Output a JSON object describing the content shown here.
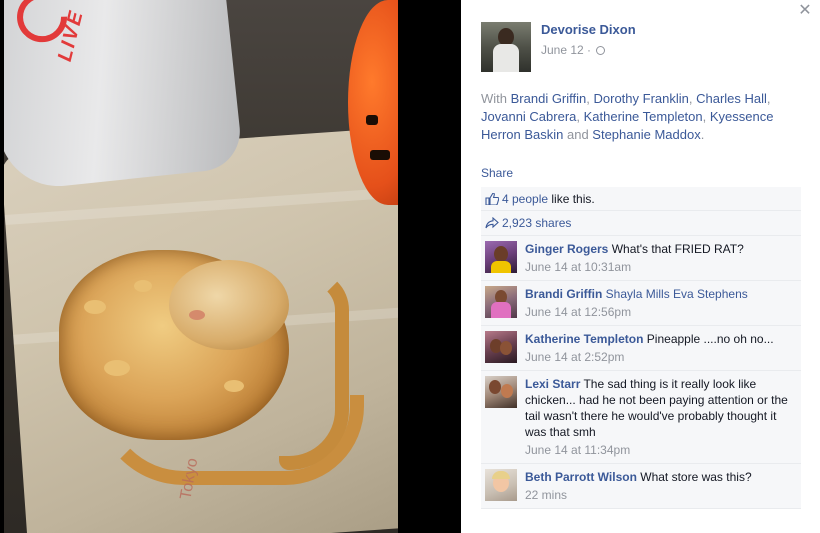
{
  "photo": {
    "cup_text": "LIVE",
    "wrapper_text": "Tokyo"
  },
  "close_icon": "✕",
  "post": {
    "author": "Devorise Dixon",
    "date": "June 12",
    "date_separator": " · ",
    "privacy_icon": "globe-icon",
    "with_prefix": "With ",
    "tagged": [
      "Brandi Griffin",
      "Dorothy Franklin",
      "Charles Hall",
      "Jovanni Cabrera",
      "Katherine Templeton",
      "Kyessence Herron Baskin",
      "Stephanie Maddox"
    ],
    "sep_comma": ", ",
    "sep_and": " and ",
    "end_period": ".",
    "share_label": "Share"
  },
  "ufi": {
    "likes_count": "4 people",
    "likes_suffix": " like this.",
    "shares_count": "2,923 shares"
  },
  "comments": [
    {
      "name": "Ginger Rogers",
      "text": " What's that FRIED RAT?",
      "time": "June 14 at 10:31am"
    },
    {
      "name": "Brandi Griffin",
      "tag": " Shayla Mills Eva Stephens",
      "time": "June 14 at 12:56pm"
    },
    {
      "name": "Katherine Templeton",
      "text": " Pineapple ....no oh no...",
      "time": "June 14 at 2:52pm"
    },
    {
      "name": "Lexi Starr",
      "text": " The sad thing is it really look like chicken... had he not been paying attention or the tail wasn't there he would've probably thought it was that smh",
      "time": "June 14 at 11:34pm"
    },
    {
      "name": "Beth Parrott Wilson",
      "text": " What store was this?",
      "time": "22 mins"
    }
  ],
  "colors": {
    "link_blue": "#3b5998",
    "muted_gray": "#90949c",
    "ufi_bg": "#f6f7f9"
  }
}
